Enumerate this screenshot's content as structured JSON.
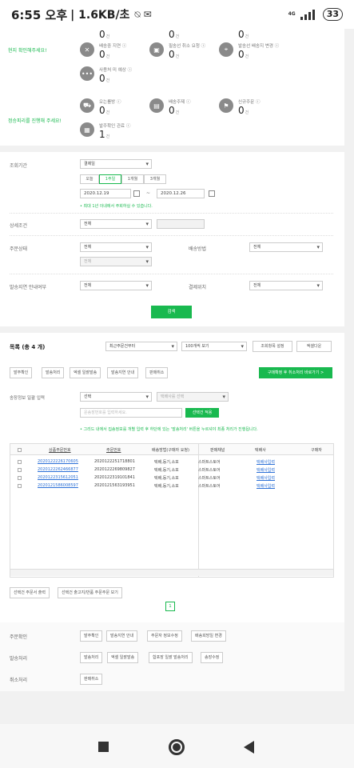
{
  "statusbar": {
    "time": "6:55 오후",
    "info": "| 1.6KB/초",
    "network": "4G",
    "battery": "33"
  },
  "summary": {
    "row1_note": "현지 확인해주세요!",
    "row2_note": "정승피리를 진행해 주세요!",
    "stats": [
      {
        "label": "",
        "count": "0",
        "unit": "건",
        "icon": "box-icon"
      },
      {
        "label": "",
        "count": "0",
        "unit": "건",
        "icon": "box-icon"
      },
      {
        "label": "",
        "count": "0",
        "unit": "건",
        "icon": "box-icon"
      },
      {
        "label": "배송중 지연 ⓘ",
        "count": "0",
        "unit": "건",
        "icon": "delay-icon"
      },
      {
        "label": "필송선 취소 요청 ⓘ",
        "count": "0",
        "unit": "건",
        "icon": "bag-icon"
      },
      {
        "label": "발송선 배송지 변경 ⓘ",
        "count": "0",
        "unit": "건",
        "icon": "location-icon"
      },
      {
        "label": "사용처 미 예상 ⓘ",
        "count": "0",
        "unit": "건",
        "icon": "more-icon"
      },
      {
        "label": "오는를방 ⓘ",
        "count": "0",
        "unit": "건",
        "icon": "truck-icon"
      },
      {
        "label": "배송주제 ⓘ",
        "count": "0",
        "unit": "건",
        "icon": "doc-icon"
      },
      {
        "label": "신규주문 ⓘ",
        "count": "0",
        "unit": "건",
        "icon": "pin-icon"
      },
      {
        "label": "발주확인 관료 ⓘ",
        "count": "1",
        "unit": "건",
        "icon": "paper-icon"
      }
    ]
  },
  "search": {
    "period_label": "조회기간",
    "period_select": "결제일",
    "ranges": [
      "오늘",
      "1주일",
      "1개월",
      "3개월"
    ],
    "date_from": "2020.12.19",
    "date_sep": "~",
    "date_to": "2020.12.26",
    "note": "• 최대 1년 이내에서 주회하실 수 있습니다.",
    "detail_label": "상세조건",
    "detail_select": "전체",
    "status_label": "주문상태",
    "status_select": "전체",
    "status_sub": "전체",
    "delivery_label": "배송방법",
    "delivery_select": "전체",
    "delay_label": "발송지연 안내여부",
    "delay_select": "전체",
    "pay_label": "결제위치",
    "pay_select": "전체",
    "search_button": "검색"
  },
  "list": {
    "title": "목록 (총 4 개)",
    "sort_select": "최근주문건부터",
    "page_select": "100개씩 보기",
    "settings_button": "조회항목 설정",
    "excel_button": "엑셀다운",
    "tabs": [
      "발주확인",
      "발송처리",
      "엑셀 일괄발송",
      "발송지연 안내",
      "판매취소"
    ],
    "green_action": "구매확정 후 취소처리 바로가기 >",
    "ship_label": "송장정보 일괄 입력",
    "ship_select": "선택",
    "ship_company": "택배사를 선택",
    "ship_input_placeholder": "운송장번호를 입력하세요.",
    "ship_apply": "선택건 적용",
    "notice": "• 그리드 내에서 집송정보를 개별 입력 후 하단에 있는 '발송처리' 버튼을 누르셔야 최종 처리가 진행됩니다.",
    "columns": [
      "상품주문번호",
      "주문번호",
      "배송방법(구매자 요청)",
      "판매채널",
      "택배사",
      "구매자"
    ],
    "rows": [
      {
        "order_item": "2020122226170605",
        "order": "2020122251718801",
        "method": "택배,등기,소포",
        "channel": "스마트스토어",
        "courier": "택배사입력"
      },
      {
        "order_item": "2020122262466877",
        "order": "2020122269809827",
        "method": "택배,등기,소포",
        "channel": "스마트스토어",
        "courier": "택배사입력"
      },
      {
        "order_item": "2020122315612051",
        "order": "2020122319101841",
        "method": "택배,등기,소포",
        "channel": "스마트스토어",
        "courier": "택배사입력"
      },
      {
        "order_item": "2020121586008597",
        "order": "2020121563193951",
        "method": "택배,등기,소포",
        "channel": "스마트스토어",
        "courier": "택배사입력"
      }
    ],
    "footer_buttons": [
      "선택건 주문서 출력",
      "선택건 출고지/반품 주문주문 보기"
    ],
    "page": "1"
  },
  "actions": {
    "confirm_label": "주문확인",
    "confirm_buttons": [
      "발주확인",
      "발송지연 안내",
      "주문자 정보수정",
      "배송희망일 변경"
    ],
    "ship_label": "발송처리",
    "ship_buttons": [
      "발송처리",
      "엑셀 일괄발송",
      "합포장 일괄 발송처리",
      "송장수정"
    ],
    "cancel_label": "취소처리",
    "cancel_buttons": [
      "판매취소"
    ]
  },
  "colors": {
    "accent": "#19b94f",
    "link": "#2a6fd6"
  }
}
